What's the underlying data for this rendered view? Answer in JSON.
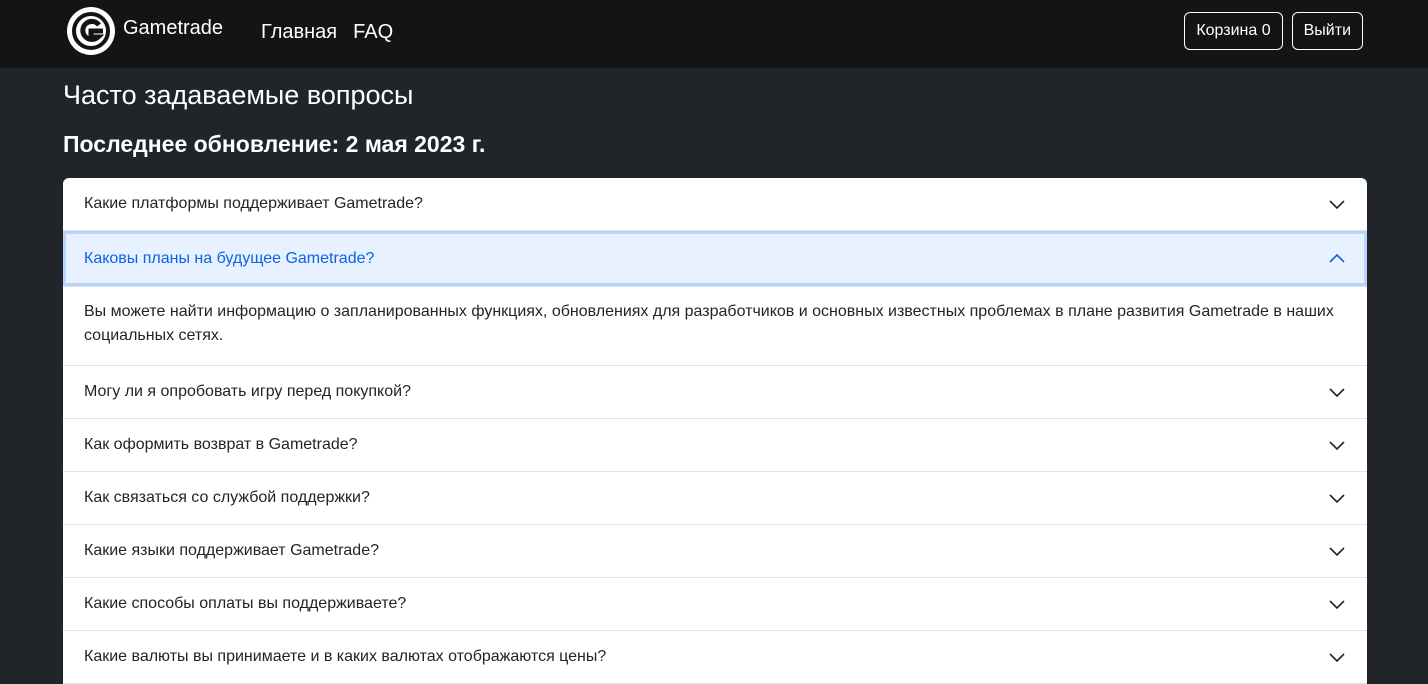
{
  "nav": {
    "brand": "Gametrade",
    "links": [
      "Главная",
      "FAQ"
    ],
    "cart_label": "Корзина 0",
    "logout_label": "Выйти"
  },
  "page": {
    "title": "Часто задаваемые вопросы",
    "updated": "Последнее обновление: 2 мая 2023 г."
  },
  "faq": {
    "items": [
      {
        "question": "Какие платформы поддерживает Gametrade?",
        "open": false
      },
      {
        "question": "Каковы планы на будущее Gametrade?",
        "open": true,
        "answer": "Вы можете найти информацию о запланированных функциях, обновлениях для разработчиков и основных известных проблемах в плане развития Gametrade в наших социальных сетях."
      },
      {
        "question": "Могу ли я опробовать игру перед покупкой?",
        "open": false
      },
      {
        "question": "Как оформить возврат в Gametrade?",
        "open": false
      },
      {
        "question": "Как связаться со службой поддержки?",
        "open": false
      },
      {
        "question": "Какие языки поддерживает Gametrade?",
        "open": false
      },
      {
        "question": "Какие способы оплаты вы поддерживаете?",
        "open": false
      },
      {
        "question": "Какие валюты вы принимаете и в каких валютах отображаются цены?",
        "open": false
      }
    ]
  },
  "colors": {
    "navbar": "#141414",
    "page_bg": "#212529",
    "active_header_bg": "#e7f1ff",
    "active_header_text": "#0c63e4"
  },
  "icons": {
    "logo": "gametrade-logo-icon",
    "collapsed": "chevron-down-icon",
    "expanded": "chevron-up-icon"
  }
}
